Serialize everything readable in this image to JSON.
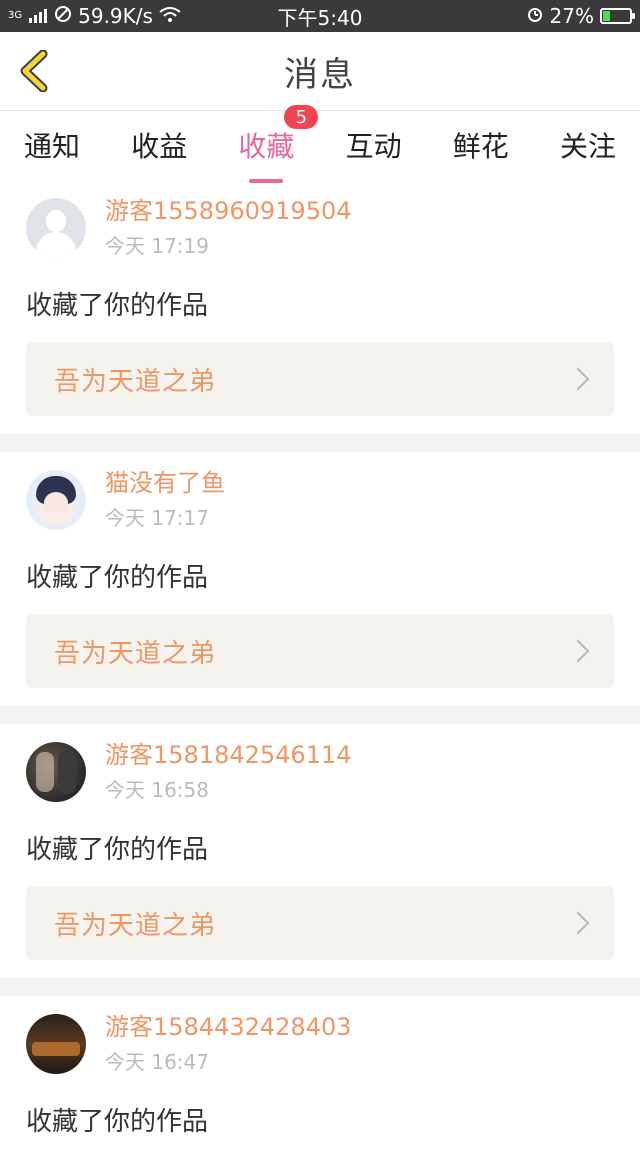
{
  "status_bar": {
    "network": "3G",
    "speed": "59.9K/s",
    "time": "下午5:40",
    "battery": "27%",
    "battery_level": 0.27
  },
  "header": {
    "title": "消息"
  },
  "tabs": [
    {
      "label": "通知"
    },
    {
      "label": "收益"
    },
    {
      "label": "收藏",
      "badge": "5",
      "active": true
    },
    {
      "label": "互动"
    },
    {
      "label": "鲜花"
    },
    {
      "label": "关注"
    }
  ],
  "messages": [
    {
      "user": "游客1558960919504",
      "time": "今天 17:19",
      "action": "收藏了你的作品",
      "work": "吾为天道之弟",
      "avatar": "default-avatar"
    },
    {
      "user": "猫没有了鱼",
      "time": "今天 17:17",
      "action": "收藏了你的作品",
      "work": "吾为天道之弟",
      "avatar": "anime-avatar"
    },
    {
      "user": "游客1581842546114",
      "time": "今天 16:58",
      "action": "收藏了你的作品",
      "work": "吾为天道之弟",
      "avatar": "photo-avatar"
    },
    {
      "user": "游客1584432428403",
      "time": "今天 16:47",
      "action": "收藏了你的作品",
      "work": "",
      "avatar": "poster-avatar"
    }
  ],
  "colors": {
    "accent_pink": "#e8679c",
    "name_orange": "#ef9664",
    "badge_red": "#f0444f",
    "back_arrow_yellow": "#f5d53a"
  }
}
